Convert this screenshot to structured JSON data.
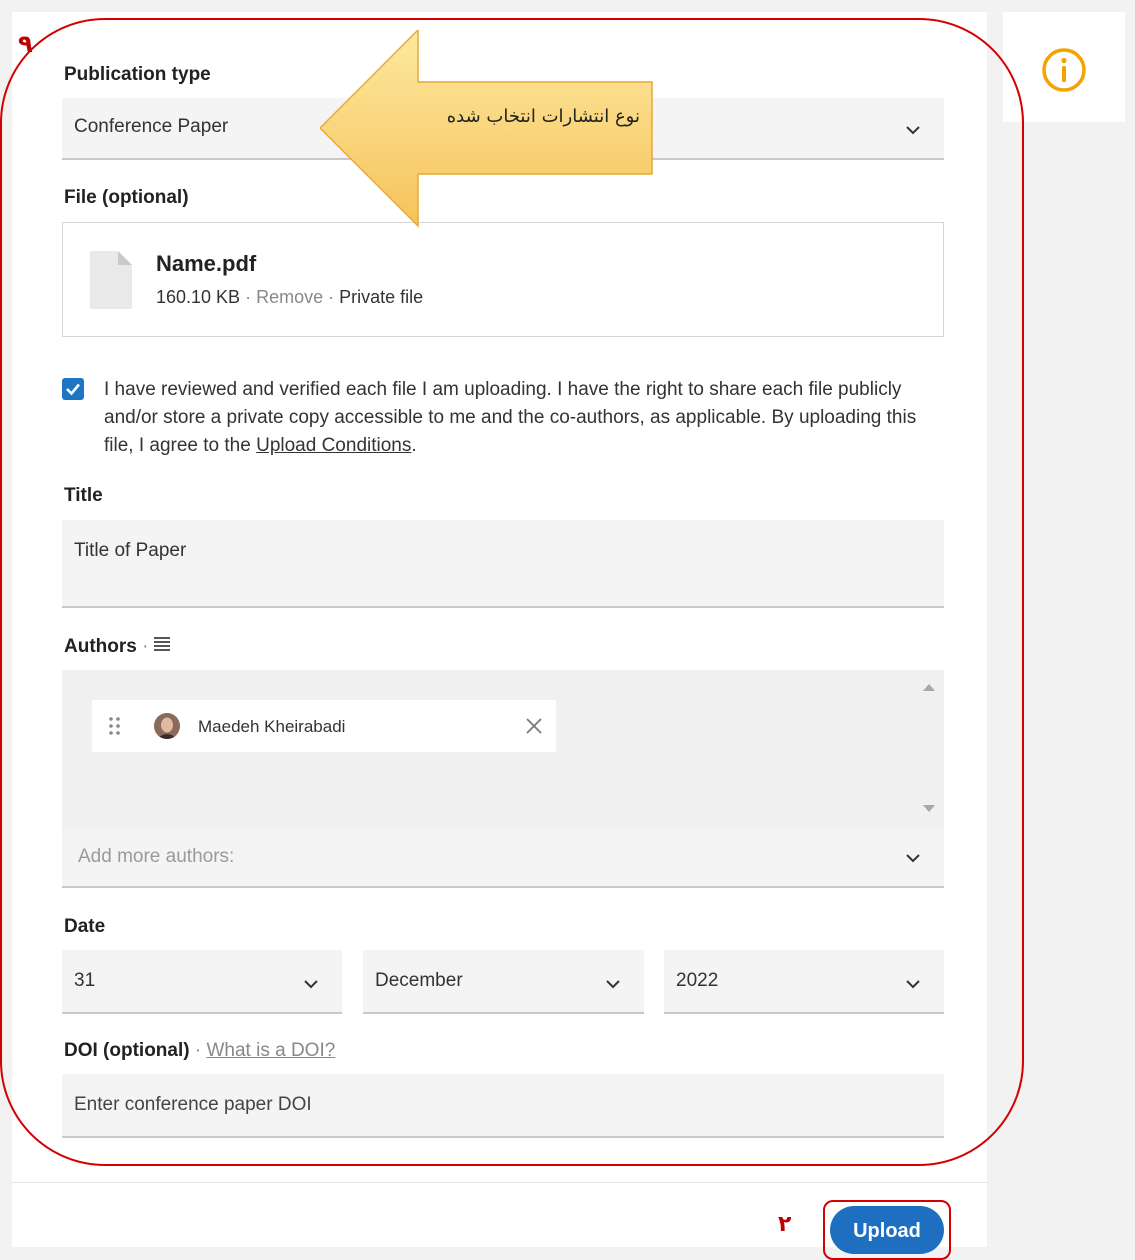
{
  "annotations": {
    "frame_number": "۹",
    "upload_number": "۲",
    "arrow_label": "نوع انتشارات انتخاب شده"
  },
  "form": {
    "publication_type": {
      "label": "Publication type",
      "value": "Conference Paper"
    },
    "file": {
      "label": "File (optional)",
      "name": "Name.pdf",
      "size": "160.10 KB",
      "separator": " · ",
      "remove": "Remove",
      "privacy": "Private file"
    },
    "consent": {
      "checked": true,
      "text": "I have reviewed and verified each file I am uploading. I have the right to share each file publicly and/or store a private copy accessible to me and the co-authors, as applicable. By uploading this file, I agree to the ",
      "link": "Upload Conditions",
      "end": "."
    },
    "title": {
      "label": "Title",
      "value": "Title of Paper"
    },
    "authors": {
      "label": "Authors",
      "sep": " · ",
      "list": [
        {
          "name": "Maedeh Kheirabadi"
        }
      ],
      "add_placeholder": "Add more authors:"
    },
    "date": {
      "label": "Date",
      "day": "31",
      "month": "December",
      "year": "2022"
    },
    "doi": {
      "label": "DOI (optional)",
      "sep": " · ",
      "help_link": "What is a DOI?",
      "placeholder": "Enter conference paper DOI"
    }
  },
  "actions": {
    "upload_label": "Upload"
  },
  "colors": {
    "accent": "#1f6fc0",
    "annotation_red": "#d50000",
    "info_orange": "#f5a300"
  }
}
